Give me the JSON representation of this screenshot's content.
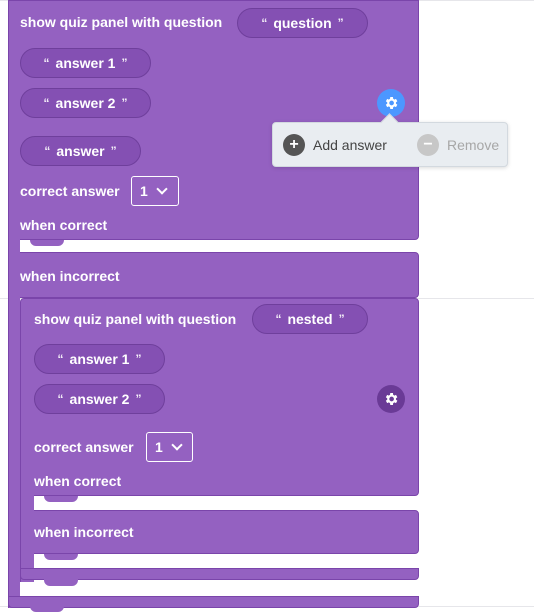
{
  "outer": {
    "title": "show quiz panel with question",
    "question": "question",
    "answers": [
      "answer 1",
      "answer 2",
      "answer"
    ],
    "correct_label": "correct answer",
    "correct_value": "1",
    "when_correct": "when correct",
    "when_incorrect": "when incorrect"
  },
  "nested": {
    "title": "show quiz panel with question",
    "question": "nested",
    "answers": [
      "answer 1",
      "answer 2"
    ],
    "correct_label": "correct answer",
    "correct_value": "1",
    "when_correct": "when correct",
    "when_incorrect": "when incorrect"
  },
  "popup": {
    "add_label": "Add answer",
    "remove_label": "Remove"
  },
  "quote_open": "“",
  "quote_close": "”",
  "colors": {
    "block": "#9461c1",
    "gear_active": "#4c97ff",
    "gear_idle": "#6a3a96"
  },
  "icons": [
    "gear-icon",
    "plus-icon",
    "minus-icon",
    "chevron-down-icon"
  ]
}
